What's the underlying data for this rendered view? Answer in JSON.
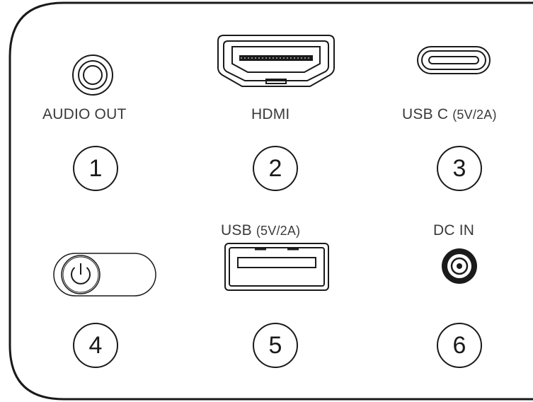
{
  "ports": {
    "audio_out": {
      "label": "AUDIO OUT"
    },
    "hdmi": {
      "label": "HDMI"
    },
    "usb_c": {
      "label_main": "USB C",
      "label_spec": "(5V/2A)"
    },
    "usb": {
      "label_main": "USB",
      "label_spec": "(5V/2A)"
    },
    "dc_in": {
      "label": "DC IN"
    }
  },
  "callouts": [
    "1",
    "2",
    "3",
    "4",
    "5",
    "6"
  ],
  "colors": {
    "stroke": "#1a1a1a",
    "label": "#3a3a3a",
    "background": "#ffffff"
  }
}
